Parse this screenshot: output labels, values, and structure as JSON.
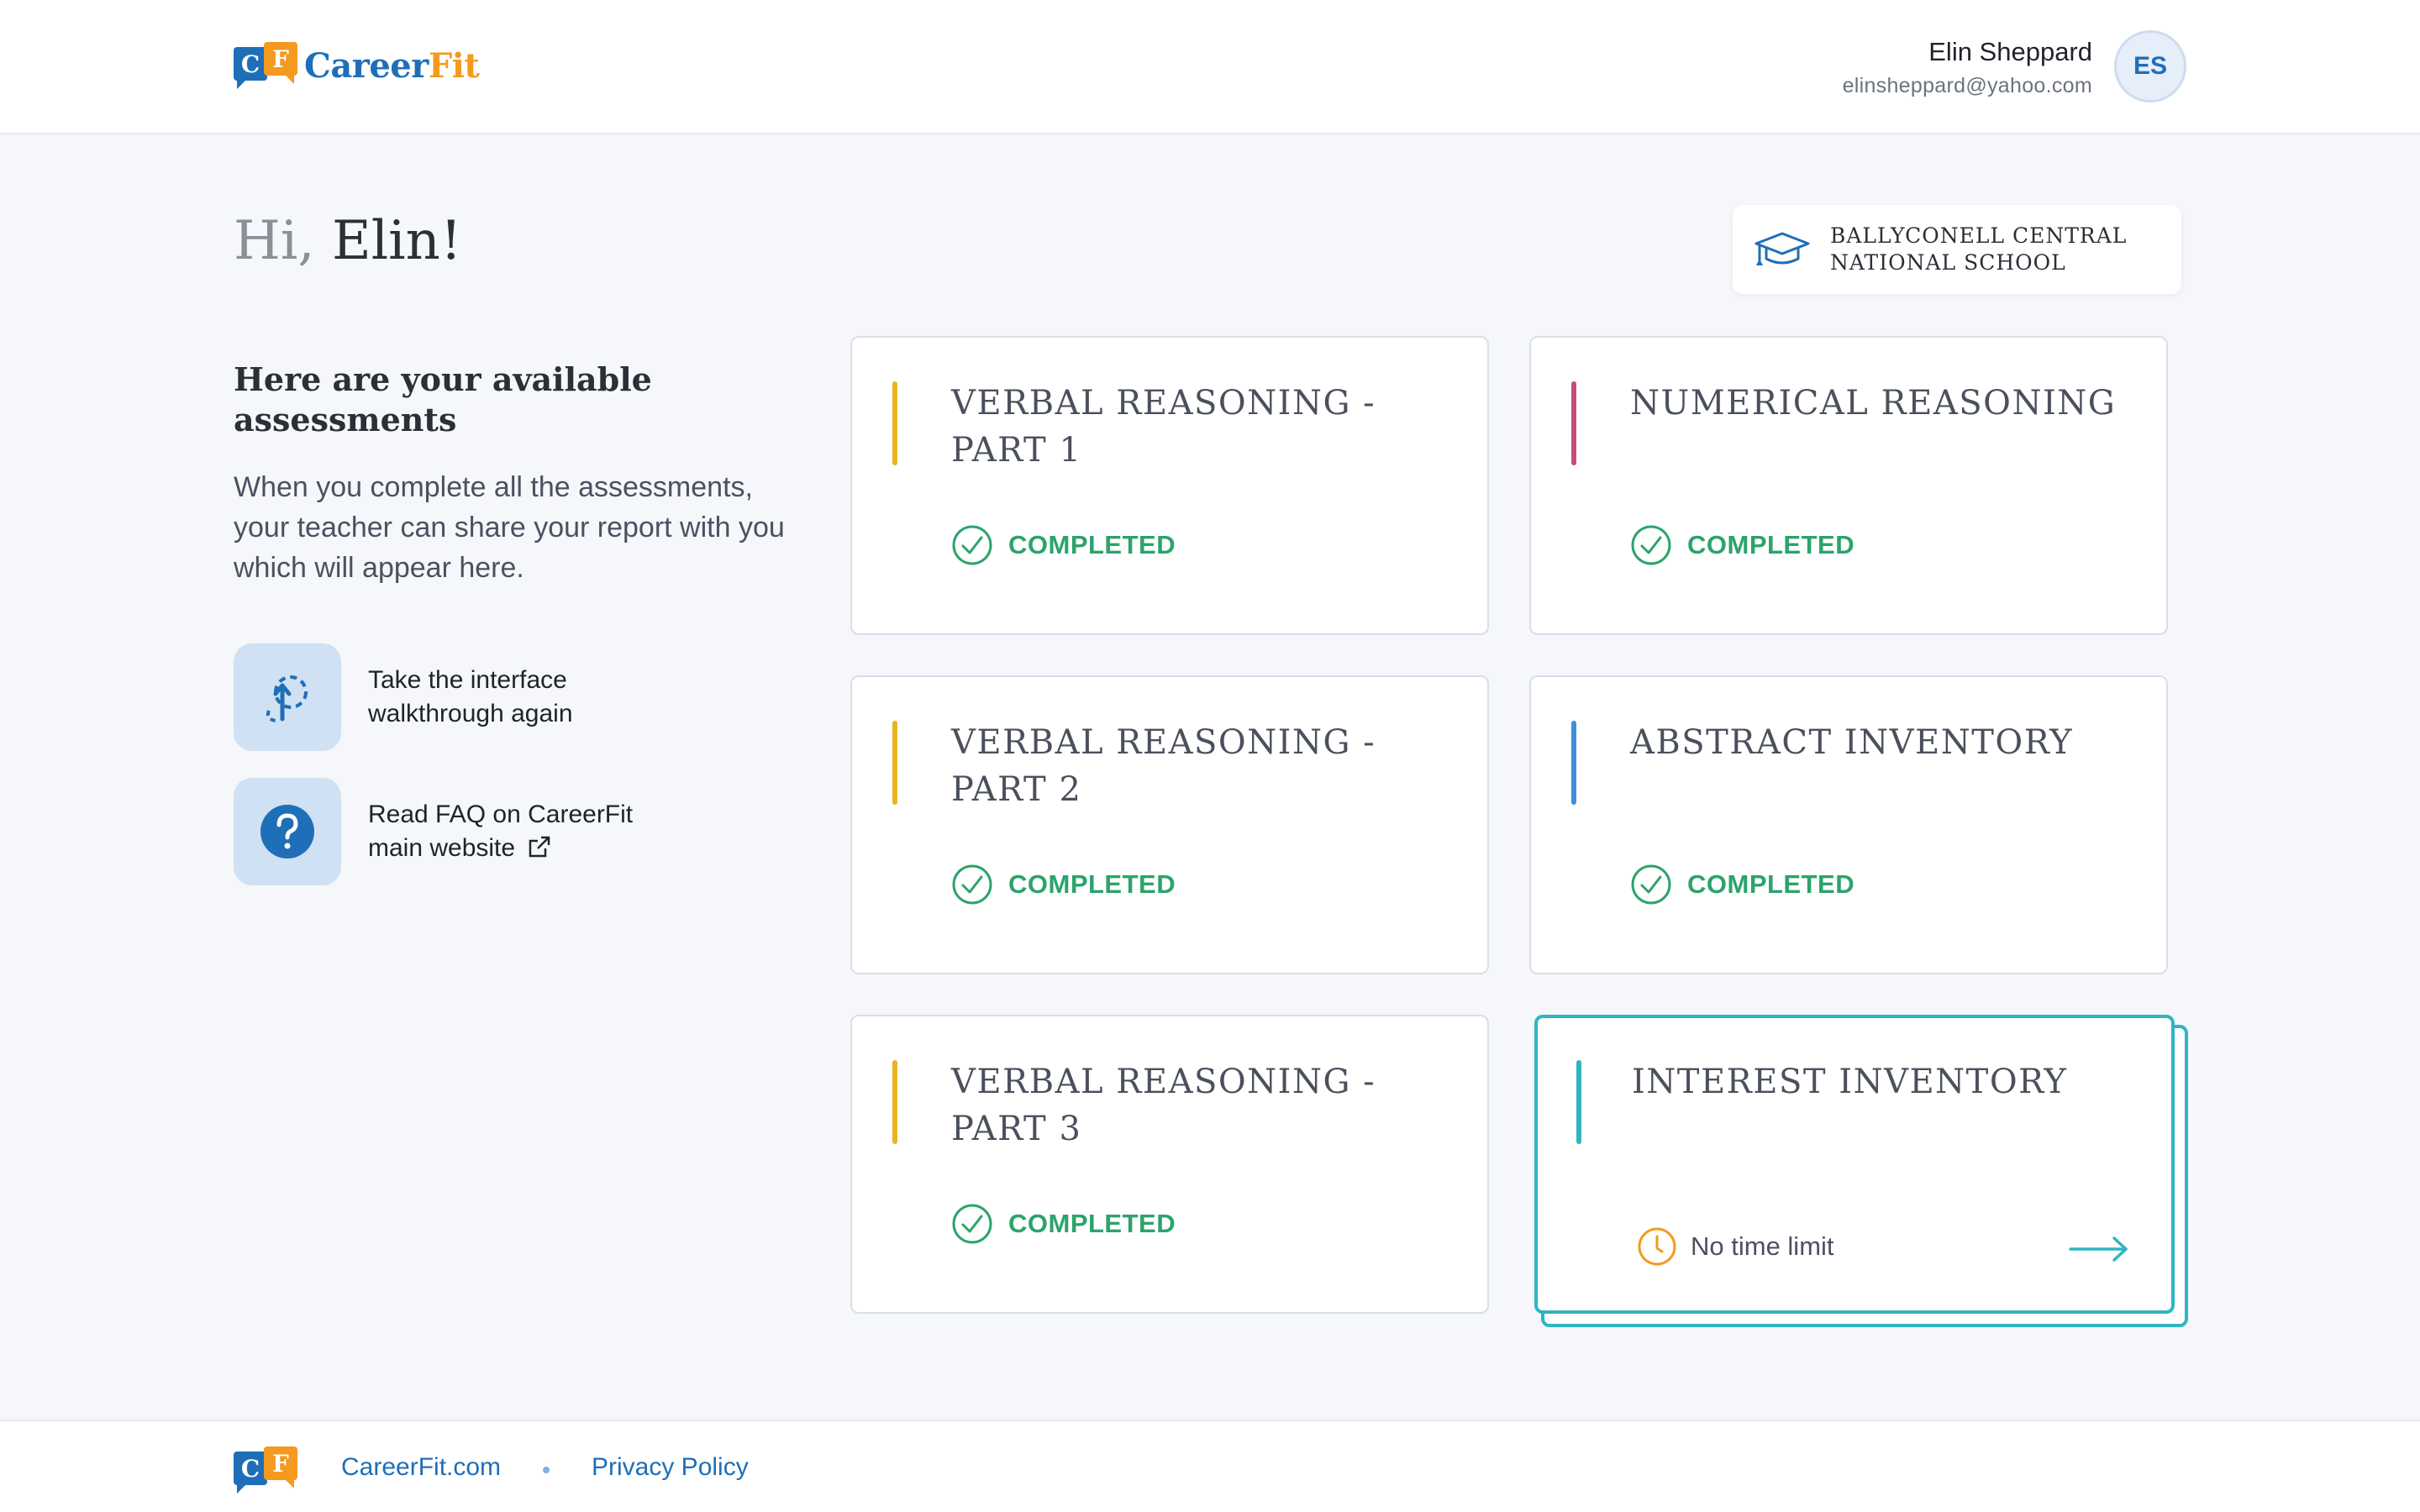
{
  "brand": {
    "logo_c": "C",
    "logo_f": "F",
    "name_part1": "Career",
    "name_part2": "Fit"
  },
  "user": {
    "name": "Elin Sheppard",
    "email": "elinsheppard@yahoo.com",
    "initials": "ES"
  },
  "greeting": {
    "hi": "Hi,",
    "name": "Elin!"
  },
  "school": {
    "name": "BALLYCONELL CENTRAL NATIONAL SCHOOL",
    "icon": "graduation-cap-icon"
  },
  "intro": {
    "title": "Here are your available assessments",
    "text": "When you complete all the assessments, your teacher can share your report with you which will appear here."
  },
  "actions": [
    {
      "label": "Take the interface walkthrough again",
      "icon": "walkthrough-icon"
    },
    {
      "label": "Read FAQ on CareerFit main website",
      "icon": "question-icon"
    }
  ],
  "assessments": [
    {
      "title": "VERBAL REASONING - PART 1",
      "status": "COMPLETED",
      "accent": "#e8b423"
    },
    {
      "title": "NUMERICAL REASONING",
      "status": "COMPLETED",
      "accent": "#c94a7c"
    },
    {
      "title": "VERBAL REASONING - PART 2",
      "status": "COMPLETED",
      "accent": "#e8b423"
    },
    {
      "title": "ABSTRACT INVENTORY",
      "status": "COMPLETED",
      "accent": "#3f8fd9"
    },
    {
      "title": "VERBAL REASONING - PART 3",
      "status": "COMPLETED",
      "accent": "#e8b423"
    },
    {
      "title": "INTEREST INVENTORY",
      "time": "No time limit",
      "accent": "#2fb5c2"
    }
  ],
  "footer": {
    "site": "CareerFit.com",
    "privacy": "Privacy Policy"
  },
  "colors": {
    "primary": "#1e6fb8",
    "orange": "#f39a1f",
    "success": "#2ca36b",
    "teal": "#2fb5c2"
  }
}
